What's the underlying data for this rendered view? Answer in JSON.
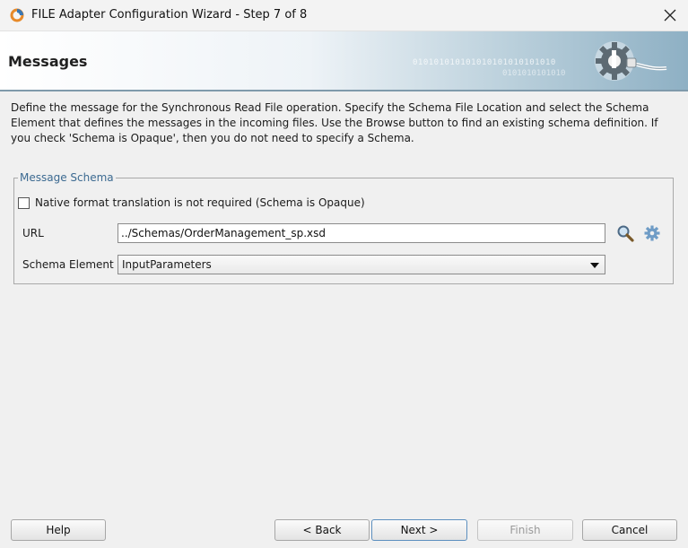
{
  "window": {
    "title": "FILE Adapter Configuration Wizard - Step 7 of 8"
  },
  "banner": {
    "title": "Messages",
    "binary_1": "010101010101010101010101010",
    "binary_2": "0101010101010"
  },
  "description": "Define the message for the Synchronous Read File operation.  Specify the Schema File Location and select the Schema Element that defines the messages in the incoming files. Use the Browse button to find an existing schema definition. If you check 'Schema is Opaque', then you do not need to specify a Schema.",
  "message_schema": {
    "legend": "Message Schema",
    "opaque_checkbox": {
      "label": "Native format translation is not required (Schema is Opaque)",
      "checked": false
    },
    "url": {
      "label": "URL",
      "value": "../Schemas/OrderManagement_sp.xsd"
    },
    "schema_element": {
      "label": "Schema Element",
      "value": "InputParameters"
    }
  },
  "buttons": {
    "help": "Help",
    "back": "< Back",
    "next": "Next >",
    "finish": "Finish",
    "cancel": "Cancel"
  },
  "icons": {
    "app": "oracle-jdeveloper-icon",
    "close": "close-icon",
    "browse": "search-icon",
    "generate": "gear-icon"
  }
}
